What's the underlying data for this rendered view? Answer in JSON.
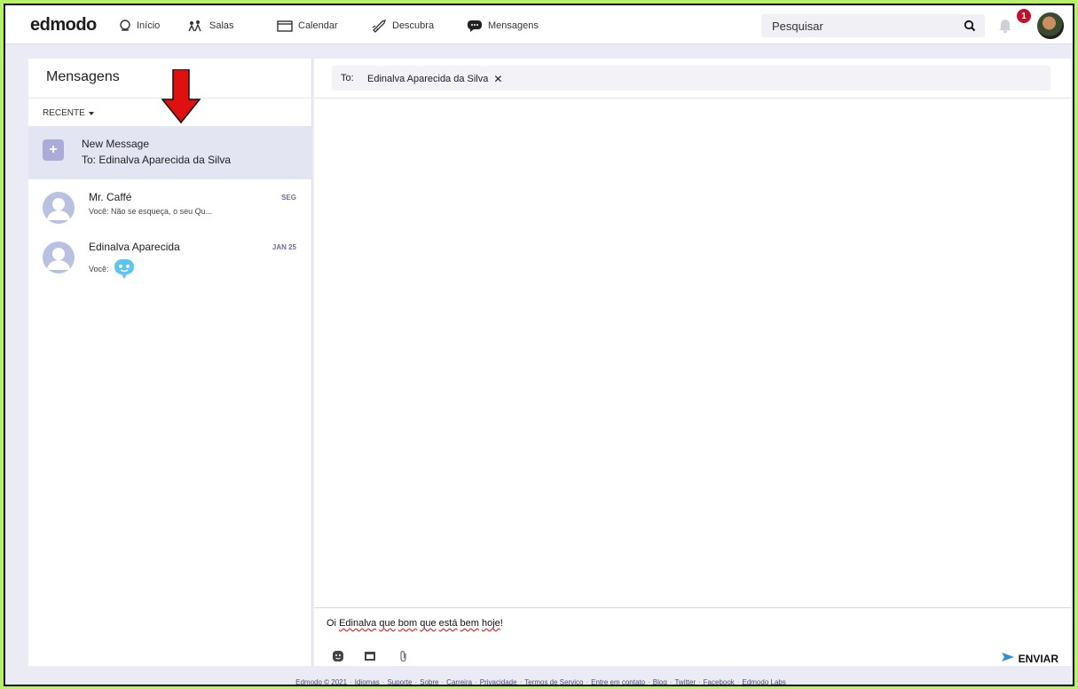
{
  "nav": {
    "logo": "edmodo",
    "items": [
      {
        "label": "Início",
        "icon": "home-icon"
      },
      {
        "label": "Salas",
        "icon": "classes-icon"
      },
      {
        "label": "Calendar",
        "icon": "calendar-icon"
      },
      {
        "label": "Descubra",
        "icon": "rocket-icon"
      },
      {
        "label": "Mensagens",
        "icon": "message-icon"
      }
    ],
    "search_placeholder": "Pesquisar",
    "notification_count": "1"
  },
  "sidebar": {
    "title": "Mensagens",
    "filter_label": "RECENTE",
    "new_message": {
      "title": "New Message",
      "to": "To: Edinalva Aparecida da Silva"
    },
    "conversations": [
      {
        "name": "Mr. Caffé",
        "date": "SEG",
        "preview": "Você: Não se esqueça, o seu Qu..."
      },
      {
        "name": "Edinalva Aparecida",
        "date": "JAN 25",
        "preview": "Você:"
      }
    ]
  },
  "compose": {
    "to_label": "To:",
    "recipient": "Edinalva Aparecida da Silva",
    "remove_symbol": "✕",
    "text_parts": [
      "Oi ",
      "Edinalva",
      " ",
      "que",
      " ",
      "bom",
      " ",
      "que",
      " ",
      "está",
      " ",
      "bem",
      " ",
      "hoje",
      "!"
    ],
    "send_label": "ENVIAR"
  },
  "footer": {
    "links": [
      "Edmodo © 2021",
      "Idiomas",
      "Suporte",
      "Sobre",
      "Carreira",
      "Privacidade",
      "Termos de Serviço",
      "Entre em contato",
      "Blog",
      "Twitter",
      "Facebook",
      "Edmodo Labs"
    ]
  },
  "colors": {
    "page_border": "#b7f06b",
    "accent": "#5c63b3",
    "badge": "#c0122e",
    "arrow": "#e01010"
  }
}
